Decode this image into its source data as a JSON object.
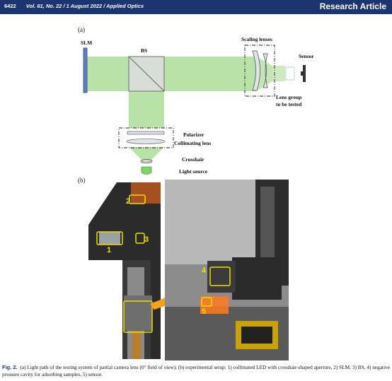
{
  "header": {
    "page_number": "6422",
    "journal_info": "Vol. 61, No. 22 / 1 August 2022 / Applied Optics",
    "article_type": "Research Article"
  },
  "figure": {
    "panel_a_label": "(a)",
    "panel_b_label": "(b)",
    "schematic_labels": {
      "slm": "SLM",
      "bs": "BS",
      "scaling_lenses": "Scaling lenses",
      "sensor": "Sensor",
      "lens_group_line1": "Lens group",
      "lens_group_line2": "to be tested",
      "polarizer": "Polarizer",
      "collimating_lens": "Collimating lens",
      "crosshair": "Crosshair",
      "light_source": "Light source"
    },
    "photo_markers": [
      "1",
      "2",
      "3",
      "4",
      "5"
    ],
    "colors": {
      "beam": "#b9e2a8",
      "slm_blue": "#5b7fbf",
      "marker_yellow": "#e8e000",
      "arrow_orange": "#f4a41a",
      "header_navy": "#1c3570"
    }
  },
  "caption": {
    "label": "Fig. 2.",
    "text": "(a) Light path of the testing system of partial camera lens (0° field of view); (b) experimental setup: 1) collimated LED with crosshair-shaped aperture, 2) SLM, 3) BS, 4) negative pressure cavity for adsorbing samples, 5) sensor."
  }
}
